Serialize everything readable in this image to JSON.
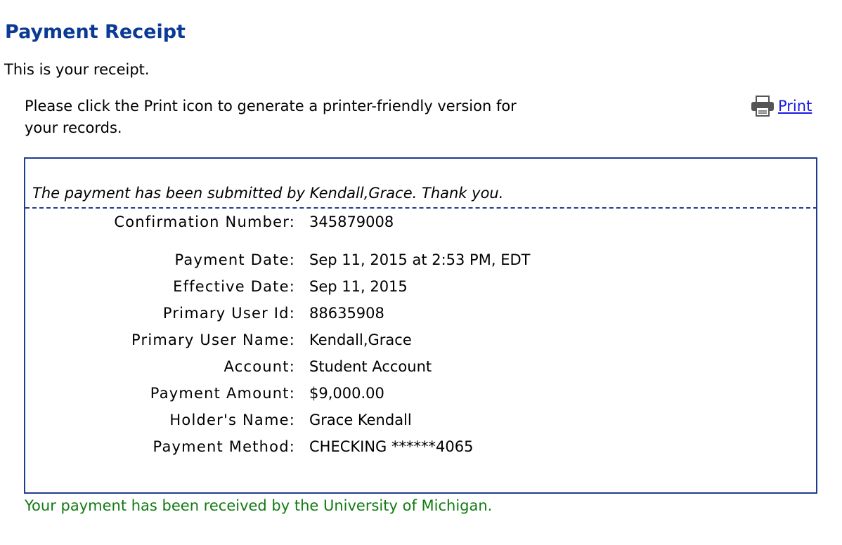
{
  "title": "Payment Receipt",
  "intro": "This is your receipt.",
  "instructions": "Please click the Print icon to generate a printer-friendly version for your records.",
  "print": {
    "label": "Print",
    "icon": "printer-icon"
  },
  "receipt": {
    "submitted_message": "The payment has been submitted by Kendall,Grace. Thank you.",
    "confirmation": {
      "label": "Confirmation Number:",
      "value": "345879008"
    },
    "fields": [
      {
        "label": "Payment Date:",
        "value": "Sep 11, 2015 at 2:53 PM, EDT"
      },
      {
        "label": "Effective Date:",
        "value": "Sep 11, 2015"
      },
      {
        "label": "Primary User Id:",
        "value": "88635908"
      },
      {
        "label": "Primary User Name:",
        "value": "Kendall,Grace"
      },
      {
        "label": "Account:",
        "value": "Student Account"
      },
      {
        "label": "Payment Amount:",
        "value": "$9,000.00"
      },
      {
        "label": "Holder's Name:",
        "value": "Grace Kendall"
      },
      {
        "label": "Payment Method:",
        "value": "CHECKING ******4065"
      }
    ]
  },
  "received_message": "Your payment has been received by the University of Michigan.",
  "colors": {
    "title": "#0a3a94",
    "link": "#1a1ae0",
    "box_border": "#1d3d8f",
    "success_text": "#127a12"
  }
}
